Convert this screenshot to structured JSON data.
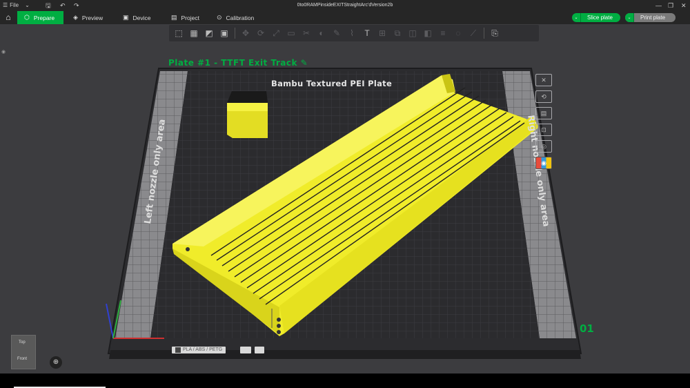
{
  "titlebar": {
    "menu_icon": "hamburger-icon",
    "file_label": "File",
    "document_title": "0to0RAMPinsideEXITStraightArc'dVersion2b"
  },
  "tabs": [
    {
      "label": "Prepare",
      "icon": "cube-icon",
      "active": true
    },
    {
      "label": "Preview",
      "icon": "layers-icon",
      "active": false
    },
    {
      "label": "Device",
      "icon": "device-icon",
      "active": false
    },
    {
      "label": "Project",
      "icon": "project-icon",
      "active": false
    },
    {
      "label": "Calibration",
      "icon": "calibration-icon",
      "active": false
    }
  ],
  "actions": {
    "slice_label": "Slice plate",
    "print_label": "Print plate"
  },
  "scene": {
    "plate_title": "Plate #1 - TTFT Exit Track",
    "bed_label": "Bambu Textured PEI Plate",
    "left_area_label": "Left nozzle only area",
    "right_area_label": "Right nozzle only area",
    "plate_number": "01",
    "filament_label": "PLA / ABS / PETG"
  },
  "view_cube": {
    "top_label": "Top",
    "front_label": "Front"
  },
  "colors": {
    "accent": "#00ae42",
    "model": "#f2ee2a",
    "bed": "#2b2b2e",
    "viewport": "#3c3c3f"
  }
}
